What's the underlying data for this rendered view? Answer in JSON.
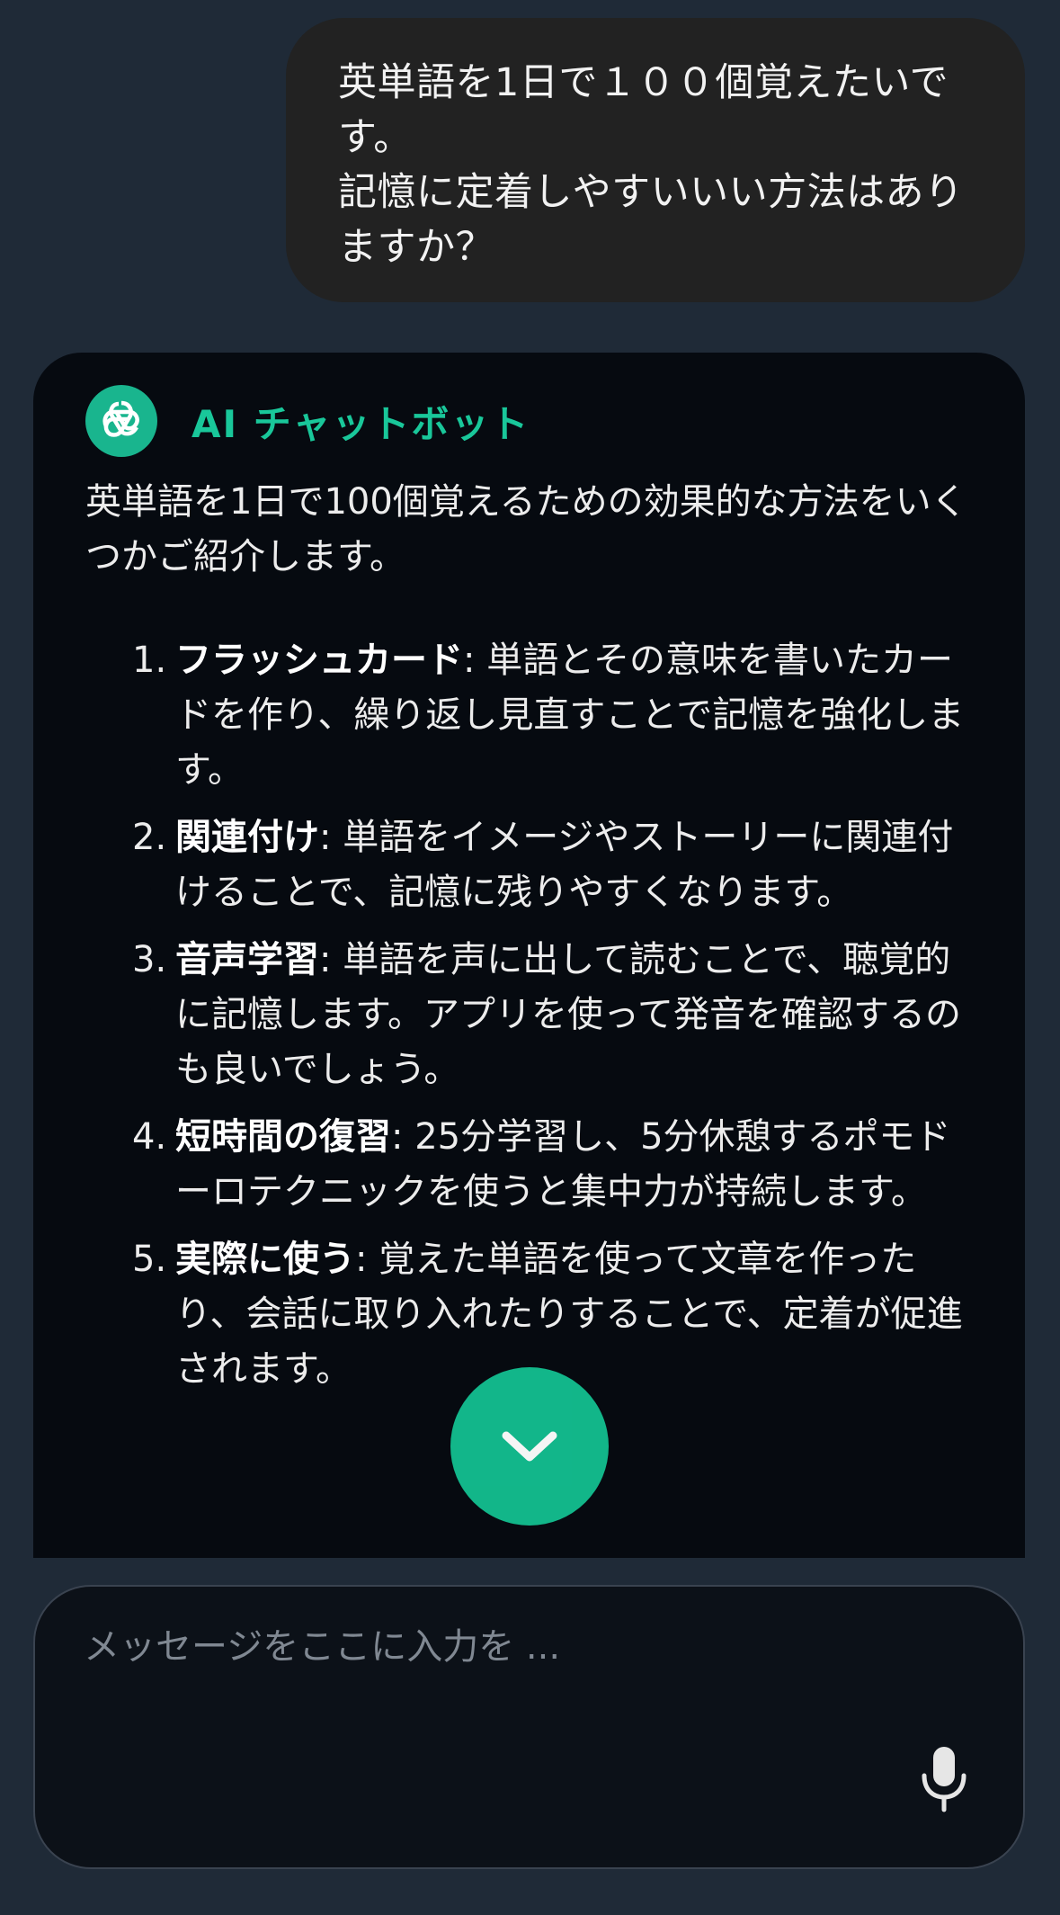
{
  "user_message": {
    "text": "英単語を1日で１００個覚えたいです。\n記憶に定着しやすいいい方法はありますか？"
  },
  "bot": {
    "name": "AI チャットボット",
    "avatar_icon": "openai-logo-icon",
    "intro": "英単語を1日で100個覚えるための効果的な方法をいくつかご紹介します。",
    "items": [
      {
        "num": "1.",
        "term": "フラッシュカード",
        "desc": ": 単語とその意味を書いたカードを作り、繰り返し見直すことで記憶を強化します。"
      },
      {
        "num": "2.",
        "term": "関連付け",
        "desc": ": 単語をイメージやストーリーに関連付けることで、記憶に残りやすくなります。"
      },
      {
        "num": "3.",
        "term": "音声学習",
        "desc": ": 単語を声に出して読むことで、聴覚的に記憶します。アプリを使って発音を確認するのも良いでしょう。"
      },
      {
        "num": "4.",
        "term": "短時間の復習",
        "desc": ": 25分学習し、5分休憩するポモドーロテクニックを使うと集中力が持続します。"
      },
      {
        "num": "5.",
        "term": "実際に使う",
        "desc": ": 覚えた単語を使って文章を作ったり、会話に取り入れたりすることで、定着が促進されます。"
      }
    ]
  },
  "scroll_button": {
    "icon": "chevron-down-icon"
  },
  "composer": {
    "placeholder": "メッセージをここに入力を ...",
    "value": "",
    "mic_icon": "microphone-icon"
  },
  "colors": {
    "background": "#1f2a37",
    "user_bubble": "#222222",
    "bot_card": "#060a10",
    "accent": "#19c79a"
  }
}
